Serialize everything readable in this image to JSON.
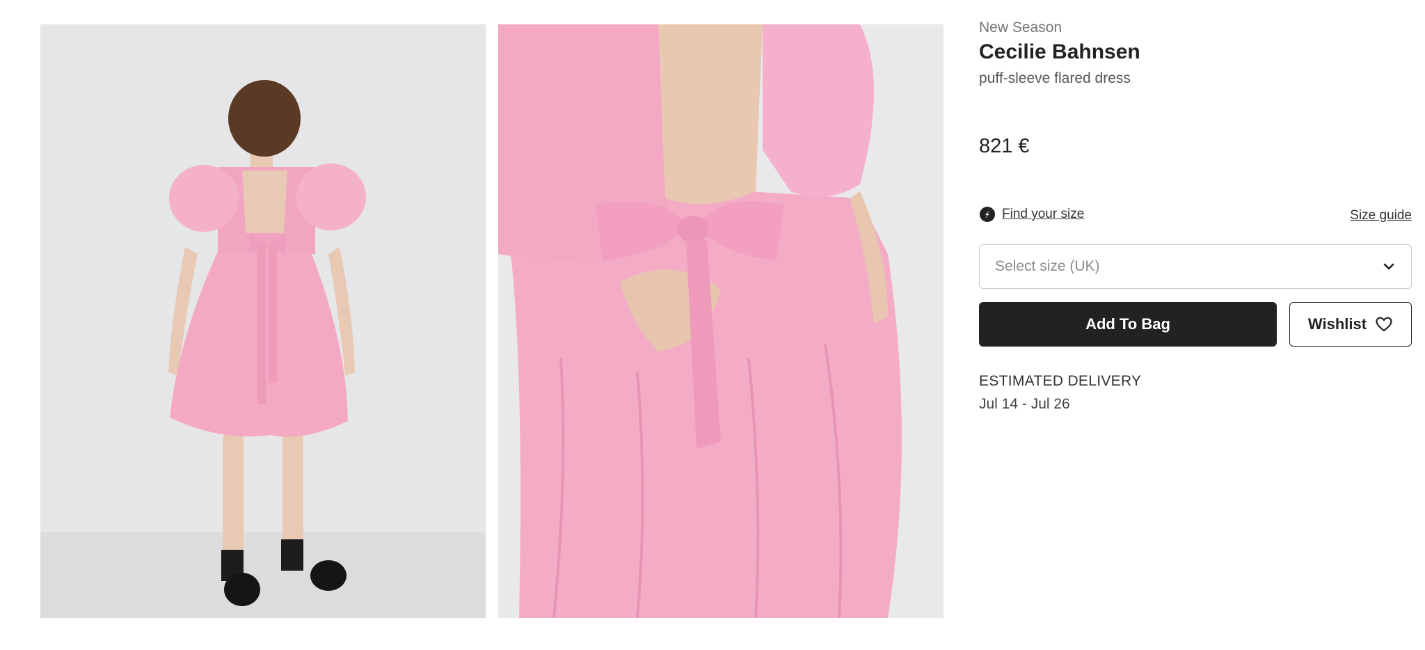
{
  "gallery": {
    "images": [
      {
        "icon": "dress-back-full-length-photo"
      },
      {
        "icon": "dress-back-closeup-photo"
      }
    ]
  },
  "product": {
    "season_label": "New Season",
    "brand": "Cecilie Bahnsen",
    "description": "puff-sleeve flared dress",
    "price": "821 €",
    "find_size_label": "Find your size",
    "find_size_icon": "size-finder-icon",
    "size_guide_label": "Size guide",
    "size_select": {
      "placeholder": "Select size (UK)",
      "icon": "chevron-down-icon"
    },
    "add_to_bag_label": "Add To Bag",
    "wishlist_label": "Wishlist",
    "wishlist_icon": "heart-icon",
    "delivery": {
      "title": "ESTIMATED DELIVERY",
      "dates": "Jul 14 - Jul 26"
    }
  },
  "colors": {
    "primary_button": "#222222",
    "dress_pink": "#f3a9c4",
    "background": "#ffffff"
  }
}
